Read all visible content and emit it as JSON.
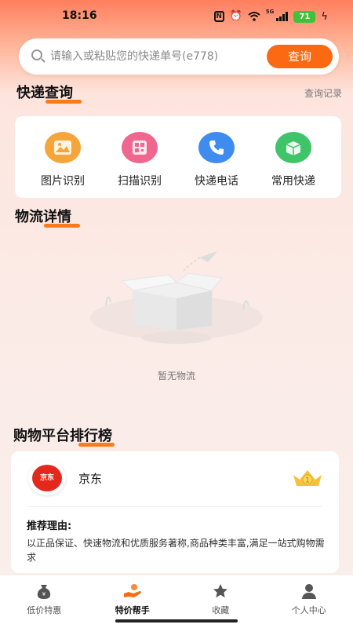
{
  "status_bar": {
    "time": "18:16",
    "network": "5G",
    "battery": "71"
  },
  "search": {
    "placeholder": "请输入或粘贴您的快递单号(e778)",
    "button_label": "查询"
  },
  "express_query": {
    "title": "快递查询",
    "history_link": "查询记录",
    "tools": [
      {
        "label": "图片识别",
        "icon": "image-recognition-icon",
        "color": "#f5a53a"
      },
      {
        "label": "扫描识别",
        "icon": "scan-recognition-icon",
        "color": "#f0668e"
      },
      {
        "label": "快递电话",
        "icon": "phone-icon",
        "color": "#3f8cf0"
      },
      {
        "label": "常用快递",
        "icon": "package-icon",
        "color": "#3fc46a"
      }
    ]
  },
  "logistics": {
    "title": "物流详情",
    "empty_text": "暂无物流"
  },
  "ranking": {
    "title": "购物平台排行榜",
    "items": [
      {
        "name": "京东",
        "logo_text": "京东",
        "rank": "1",
        "reason_title": "推荐理由:",
        "reason_text": "以正品保证、快速物流和优质服务著称,商品种类丰富,满足一站式购物需求"
      }
    ]
  },
  "tabbar": {
    "tabs": [
      {
        "label": "低价特惠",
        "icon": "money-bag-icon",
        "active": false
      },
      {
        "label": "特价帮手",
        "icon": "helper-icon",
        "active": true
      },
      {
        "label": "收藏",
        "icon": "star-icon",
        "active": false
      },
      {
        "label": "个人中心",
        "icon": "user-icon",
        "active": false
      }
    ]
  },
  "colors": {
    "accent": "#fb6a13",
    "header_gradient_top": "#ff7f5e",
    "background": "#fbebe7"
  }
}
